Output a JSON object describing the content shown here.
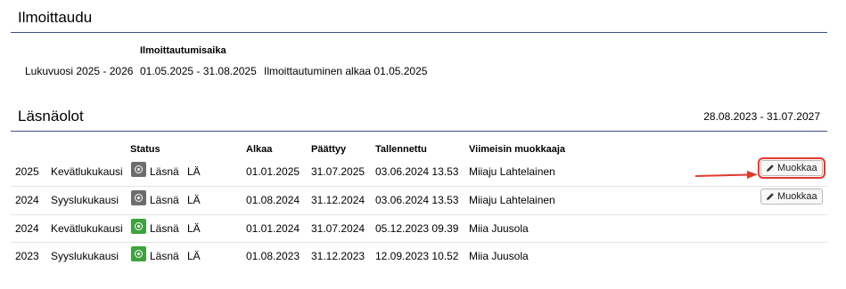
{
  "registration": {
    "title": "Ilmoittaudu",
    "column_header": "Ilmoittautumisaika",
    "row": {
      "year_label": "Lukuvuosi 2025 - 2026",
      "period": "01.05.2025 - 31.08.2025",
      "note": "Ilmoittautuminen alkaa 01.05.2025"
    }
  },
  "attendance": {
    "title": "Läsnäolot",
    "date_range": "28.08.2023 - 31.07.2027",
    "headers": {
      "status": "Status",
      "start": "Alkaa",
      "end": "Päättyy",
      "saved": "Tallennettu",
      "editor": "Viimeisin muokkaaja"
    },
    "edit_label": "Muokkaa",
    "rows": [
      {
        "year": "2025",
        "term": "Kevätlukukausi",
        "status": "Läsnä",
        "status_code": "LÄ",
        "status_color": "gray",
        "start": "01.01.2025",
        "end": "31.07.2025",
        "saved": "03.06.2024 13.53",
        "editor": "Miiaju Lahtelainen",
        "editable": true,
        "highlighted": true
      },
      {
        "year": "2024",
        "term": "Syyslukukausi",
        "status": "Läsnä",
        "status_code": "LÄ",
        "status_color": "gray",
        "start": "01.08.2024",
        "end": "31.12.2024",
        "saved": "03.06.2024 13.53",
        "editor": "Miiaju Lahtelainen",
        "editable": true,
        "highlighted": false
      },
      {
        "year": "2024",
        "term": "Kevätlukukausi",
        "status": "Läsnä",
        "status_code": "LÄ",
        "status_color": "green",
        "start": "01.01.2024",
        "end": "31.07.2024",
        "saved": "05.12.2023 09.39",
        "editor": "Miia Juusola",
        "editable": false,
        "highlighted": false
      },
      {
        "year": "2023",
        "term": "Syyslukukausi",
        "status": "Läsnä",
        "status_code": "LÄ",
        "status_color": "green",
        "start": "01.08.2023",
        "end": "31.12.2023",
        "saved": "12.09.2023 10.52",
        "editor": "Miia Juusola",
        "editable": false,
        "highlighted": false
      }
    ]
  },
  "colors": {
    "rule": "#3b4f87",
    "status_gray": "#6d6d6d",
    "status_green": "#3ea23e",
    "highlight": "#e03a2d"
  },
  "icons": {
    "status": "radio-dot-icon",
    "edit": "pencil-icon",
    "annotation": "arrow-right-icon"
  }
}
